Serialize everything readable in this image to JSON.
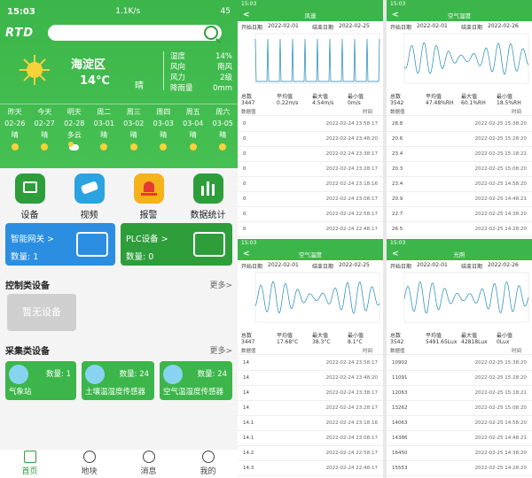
{
  "status_bar": {
    "time": "15:03",
    "network": "1.1K/s",
    "battery": "45"
  },
  "app": {
    "logo": "RTD"
  },
  "weather": {
    "district": "海淀区",
    "temp": "14℃",
    "condition": "晴",
    "stats": [
      {
        "label": "湿度",
        "value": "14%"
      },
      {
        "label": "风向",
        "value": "南风"
      },
      {
        "label": "风力",
        "value": "2级"
      },
      {
        "label": "降雨量",
        "value": "0mm"
      }
    ]
  },
  "forecast": [
    {
      "day": "昨天",
      "date": "02-26",
      "cond": "晴",
      "icon": "sun-icon"
    },
    {
      "day": "今天",
      "date": "02-27",
      "cond": "晴",
      "icon": "sun-icon"
    },
    {
      "day": "明天",
      "date": "02-28",
      "cond": "多云",
      "icon": "cloud-icon"
    },
    {
      "day": "周二",
      "date": "03-01",
      "cond": "晴",
      "icon": "sun-icon"
    },
    {
      "day": "周三",
      "date": "03-02",
      "cond": "晴",
      "icon": "sun-icon"
    },
    {
      "day": "周四",
      "date": "03-03",
      "cond": "晴",
      "icon": "sun-icon"
    },
    {
      "day": "周五",
      "date": "03-04",
      "cond": "晴",
      "icon": "sun-icon"
    },
    {
      "day": "周六",
      "date": "03-05",
      "cond": "晴",
      "icon": "sun-icon"
    }
  ],
  "nav_icons": [
    {
      "label": "设备",
      "color": "#2e9e3b"
    },
    {
      "label": "视频",
      "color": "#2ba3e0"
    },
    {
      "label": "报警",
      "color": "#f4b21b"
    },
    {
      "label": "数据统计",
      "color": "#2e9e3b"
    }
  ],
  "panels": {
    "gateway": {
      "title": "智能网关 >",
      "count": "数量: 1",
      "color": "#2b8ee0"
    },
    "plc": {
      "title": "PLC设备 >",
      "count": "数量: 0",
      "color": "#2e9e3b"
    }
  },
  "control": {
    "title": "控制类设备",
    "more": "更多>",
    "empty": "暂无设备"
  },
  "collect": {
    "title": "采集类设备",
    "more": "更多>",
    "items": [
      {
        "name": "气象站",
        "count": "数量: 1"
      },
      {
        "name": "土壤温湿度传感器",
        "count": "数量: 24"
      },
      {
        "name": "空气温湿度传感器",
        "count": "数量: 24"
      }
    ]
  },
  "tabs": [
    {
      "label": "首页"
    },
    {
      "label": "地块"
    },
    {
      "label": "消息"
    },
    {
      "label": "我的"
    }
  ],
  "detail_pages": [
    {
      "title": "风速",
      "start_label": "开始日期",
      "start": "2022-02-01",
      "end_label": "结束日期",
      "end": "2022-02-25",
      "stats": [
        {
          "l": "总数",
          "v": "3447"
        },
        {
          "l": "平均值",
          "v": "0.22m/s"
        },
        {
          "l": "最大值",
          "v": "4.54m/s"
        },
        {
          "l": "最小值",
          "v": "0m/s"
        }
      ],
      "hdr_l": "数据值",
      "hdr_r": "时间",
      "rows": [
        {
          "v": "0",
          "t": "2022-02-24 23:58:17"
        },
        {
          "v": "0",
          "t": "2022-02-24 23:48:20"
        },
        {
          "v": "0",
          "t": "2022-02-24 23:38:17"
        },
        {
          "v": "0",
          "t": "2022-02-24 23:28:17"
        },
        {
          "v": "0",
          "t": "2022-02-24 23:18:16"
        },
        {
          "v": "0",
          "t": "2022-02-24 23:08:17"
        },
        {
          "v": "0",
          "t": "2022-02-24 22:58:17"
        },
        {
          "v": "0",
          "t": "2022-02-24 22:48:17"
        },
        {
          "v": "0",
          "t": "2022-02-24 22:38:18"
        }
      ],
      "ylim": [
        0,
        4.72
      ]
    },
    {
      "title": "空气湿度",
      "start_label": "开始日期",
      "start": "2022-02-01",
      "end_label": "结束日期",
      "end": "2022-02-26",
      "stats": [
        {
          "l": "总数",
          "v": "3542"
        },
        {
          "l": "平均值",
          "v": "47.48%RH"
        },
        {
          "l": "最大值",
          "v": "60.1%RH"
        },
        {
          "l": "最小值",
          "v": "18.5%RH"
        }
      ],
      "hdr_l": "数据值",
      "hdr_r": "时间",
      "rows": [
        {
          "v": "28.8",
          "t": "2022-02-25 15:38:20"
        },
        {
          "v": "20.6",
          "t": "2022-02-25 15:28:20"
        },
        {
          "v": "23.4",
          "t": "2022-02-25 15:18:21"
        },
        {
          "v": "20.3",
          "t": "2022-02-25 15:08:20"
        },
        {
          "v": "23.4",
          "t": "2022-02-25 14:58:20"
        },
        {
          "v": "20.9",
          "t": "2022-02-25 14:48:21"
        },
        {
          "v": "22.7",
          "t": "2022-02-25 14:38:20"
        },
        {
          "v": "26.5",
          "t": "2022-02-25 14:28:20"
        },
        {
          "v": "27.3",
          "t": "2022-02-25 14:18:20"
        }
      ],
      "ylim": [
        18.5,
        62
      ]
    },
    {
      "title": "空气温度",
      "start_label": "开始日期",
      "start": "2022-02-01",
      "end_label": "结束日期",
      "end": "2022-02-25",
      "stats": [
        {
          "l": "总数",
          "v": "3447"
        },
        {
          "l": "平均值",
          "v": "17.68°C"
        },
        {
          "l": "最大值",
          "v": "38.3°C"
        },
        {
          "l": "最小值",
          "v": "8.1°C"
        }
      ],
      "hdr_l": "数据值",
      "hdr_r": "时间",
      "rows": [
        {
          "v": "14",
          "t": "2022-02-24 23:58:17"
        },
        {
          "v": "14",
          "t": "2022-02-24 23:48:20"
        },
        {
          "v": "14",
          "t": "2022-02-24 23:38:17"
        },
        {
          "v": "14",
          "t": "2022-02-24 23:28:17"
        },
        {
          "v": "14.1",
          "t": "2022-02-24 23:18:16"
        },
        {
          "v": "14.1",
          "t": "2022-02-24 23:08:17"
        },
        {
          "v": "14.2",
          "t": "2022-02-24 22:58:17"
        },
        {
          "v": "14.3",
          "t": "2022-02-24 22:48:17"
        },
        {
          "v": "14.3",
          "t": "2022-02-24 22:38:18"
        }
      ],
      "ylim": [
        8,
        39
      ]
    },
    {
      "title": "光照",
      "start_label": "开始日期",
      "start": "2022-02-01",
      "end_label": "结束日期",
      "end": "2022-02-26",
      "stats": [
        {
          "l": "总数",
          "v": "3542"
        },
        {
          "l": "平均值",
          "v": "5491.65Lux"
        },
        {
          "l": "最大值",
          "v": "42818Lux"
        },
        {
          "l": "最小值",
          "v": "0Lux"
        }
      ],
      "hdr_l": "数据值",
      "hdr_r": "时间",
      "rows": [
        {
          "v": "10902",
          "t": "2022-02-25 15:38:20"
        },
        {
          "v": "11091",
          "t": "2022-02-25 15:28:20"
        },
        {
          "v": "12063",
          "t": "2022-02-25 15:18:21"
        },
        {
          "v": "13262",
          "t": "2022-02-25 15:08:20"
        },
        {
          "v": "14063",
          "t": "2022-02-25 14:58:20"
        },
        {
          "v": "14386",
          "t": "2022-02-25 14:48:21"
        },
        {
          "v": "16450",
          "t": "2022-02-25 14:38:20"
        },
        {
          "v": "15553",
          "t": "2022-02-25 14:28:20"
        },
        {
          "v": "56664",
          "t": "2022-02-25 14:18:20"
        }
      ],
      "ylim": [
        0,
        44000
      ]
    }
  ]
}
